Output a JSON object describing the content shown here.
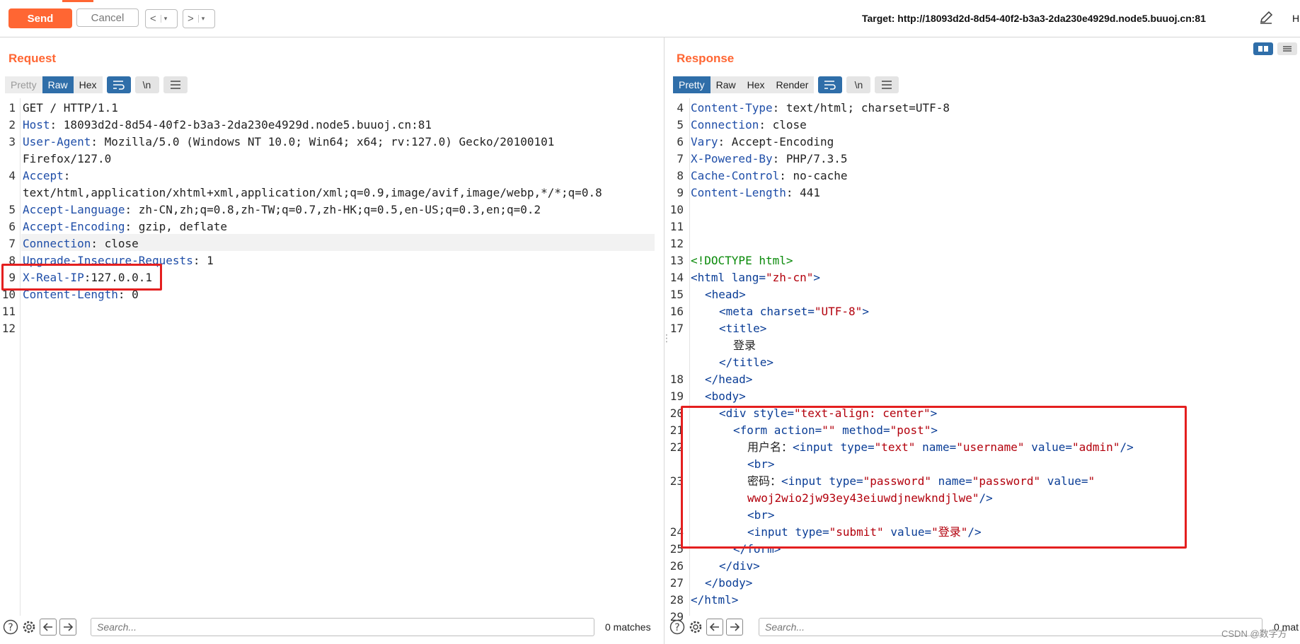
{
  "toolbar": {
    "send_label": "Send",
    "cancel_label": "Cancel",
    "back_label": "<",
    "forward_label": ">",
    "dropdown_glyph": "▾",
    "target_text": "Target: http://18093d2d-8d54-40f2-b3a3-2da230e4929d.node5.buuoj.cn:81",
    "edit_icon": "pencil-icon",
    "cut_text": "H"
  },
  "colors": {
    "accent": "#ff6633",
    "active_tab": "#2f6ea9",
    "highlight_box": "#e41f1f"
  },
  "request": {
    "title": "Request",
    "tabs": [
      "Pretty",
      "Raw",
      "Hex"
    ],
    "active_tab": "Raw",
    "tool_buttons": [
      "wrap-icon",
      "\\n",
      "menu-icon"
    ],
    "lines": [
      {
        "n": "1",
        "k": "GET / HTTP/1.1",
        "v": ""
      },
      {
        "n": "2",
        "k": "Host",
        "v": ": 18093d2d-8d54-40f2-b3a3-2da230e4929d.node5.buuoj.cn:81"
      },
      {
        "n": "3",
        "k": "User-Agent",
        "v": ": Mozilla/5.0 (Windows NT 10.0; Win64; x64; rv:127.0) Gecko/20100101"
      },
      {
        "n": "",
        "k": "",
        "v": "Firefox/127.0"
      },
      {
        "n": "4",
        "k": "Accept",
        "v": ":"
      },
      {
        "n": "",
        "k": "",
        "v": "text/html,application/xhtml+xml,application/xml;q=0.9,image/avif,image/webp,*/*;q=0.8"
      },
      {
        "n": "5",
        "k": "Accept-Language",
        "v": ": zh-CN,zh;q=0.8,zh-TW;q=0.7,zh-HK;q=0.5,en-US;q=0.3,en;q=0.2"
      },
      {
        "n": "6",
        "k": "Accept-Encoding",
        "v": ": gzip, deflate"
      },
      {
        "n": "7",
        "k": "Connection",
        "v": ": close"
      },
      {
        "n": "8",
        "k": "Upgrade-Insecure-Requests",
        "v": ": 1"
      },
      {
        "n": "9",
        "k": "X-Real-IP",
        "v": ":127.0.0.1"
      },
      {
        "n": "10",
        "k": "Content-Length",
        "v": ": 0"
      },
      {
        "n": "11",
        "k": "",
        "v": ""
      },
      {
        "n": "12",
        "k": "",
        "v": ""
      }
    ],
    "search_placeholder": "Search...",
    "matches_text": "0 matches"
  },
  "response": {
    "title": "Response",
    "tabs": [
      "Pretty",
      "Raw",
      "Hex",
      "Render"
    ],
    "active_tab": "Pretty",
    "tool_buttons": [
      "wrap-icon",
      "\\n",
      "menu-icon"
    ],
    "lines": [
      {
        "n": "4",
        "indent": 0,
        "parts": [
          [
            "hk",
            "Content-Type"
          ],
          [
            "t-txt",
            ": text/html; charset=UTF-8"
          ]
        ]
      },
      {
        "n": "5",
        "indent": 0,
        "parts": [
          [
            "hk",
            "Connection"
          ],
          [
            "t-txt",
            ": close"
          ]
        ]
      },
      {
        "n": "6",
        "indent": 0,
        "parts": [
          [
            "hk",
            "Vary"
          ],
          [
            "t-txt",
            ": Accept-Encoding"
          ]
        ]
      },
      {
        "n": "7",
        "indent": 0,
        "parts": [
          [
            "hk",
            "X-Powered-By"
          ],
          [
            "t-txt",
            ": PHP/7.3.5"
          ]
        ]
      },
      {
        "n": "8",
        "indent": 0,
        "parts": [
          [
            "hk",
            "Cache-Control"
          ],
          [
            "t-txt",
            ": no-cache"
          ]
        ]
      },
      {
        "n": "9",
        "indent": 0,
        "parts": [
          [
            "hk",
            "Content-Length"
          ],
          [
            "t-txt",
            ": 441"
          ]
        ]
      },
      {
        "n": "10",
        "indent": 0,
        "parts": []
      },
      {
        "n": "11",
        "indent": 0,
        "parts": []
      },
      {
        "n": "12",
        "indent": 0,
        "parts": []
      },
      {
        "n": "13",
        "indent": 0,
        "parts": [
          [
            "t-doc",
            "<!DOCTYPE html>"
          ]
        ]
      },
      {
        "n": "14",
        "indent": 0,
        "parts": [
          [
            "t-tag",
            "<html "
          ],
          [
            "t-attr",
            "lang"
          ],
          [
            "t-tag",
            "="
          ],
          [
            "t-val",
            "\"zh-cn\""
          ],
          [
            "t-tag",
            ">"
          ]
        ]
      },
      {
        "n": "15",
        "indent": 1,
        "parts": [
          [
            "t-tag",
            "<head>"
          ]
        ]
      },
      {
        "n": "16",
        "indent": 2,
        "parts": [
          [
            "t-tag",
            "<meta "
          ],
          [
            "t-attr",
            "charset"
          ],
          [
            "t-tag",
            "="
          ],
          [
            "t-val",
            "\"UTF-8\""
          ],
          [
            "t-tag",
            ">"
          ]
        ]
      },
      {
        "n": "17",
        "indent": 2,
        "parts": [
          [
            "t-tag",
            "<title>"
          ]
        ]
      },
      {
        "n": "",
        "indent": 3,
        "parts": [
          [
            "t-txt",
            "登录"
          ]
        ]
      },
      {
        "n": "",
        "indent": 2,
        "parts": [
          [
            "t-tag",
            "</title>"
          ]
        ]
      },
      {
        "n": "18",
        "indent": 1,
        "parts": [
          [
            "t-tag",
            "</head>"
          ]
        ]
      },
      {
        "n": "19",
        "indent": 1,
        "parts": [
          [
            "t-tag",
            "<body>"
          ]
        ]
      },
      {
        "n": "20",
        "indent": 2,
        "parts": [
          [
            "t-tag",
            "<div "
          ],
          [
            "t-attr",
            "style"
          ],
          [
            "t-tag",
            "="
          ],
          [
            "t-val",
            "\"text-align: center\""
          ],
          [
            "t-tag",
            ">"
          ]
        ]
      },
      {
        "n": "21",
        "indent": 3,
        "parts": [
          [
            "t-tag",
            "<form "
          ],
          [
            "t-attr",
            "action"
          ],
          [
            "t-tag",
            "="
          ],
          [
            "t-val",
            "\"\""
          ],
          [
            "t-tag",
            " "
          ],
          [
            "t-attr",
            "method"
          ],
          [
            "t-tag",
            "="
          ],
          [
            "t-val",
            "\"post\""
          ],
          [
            "t-tag",
            ">"
          ]
        ]
      },
      {
        "n": "22",
        "indent": 4,
        "parts": [
          [
            "t-txt",
            "用户名："
          ],
          [
            "t-tag",
            "<input "
          ],
          [
            "t-attr",
            "type"
          ],
          [
            "t-tag",
            "="
          ],
          [
            "t-val",
            "\"text\""
          ],
          [
            "t-tag",
            " "
          ],
          [
            "t-attr",
            "name"
          ],
          [
            "t-tag",
            "="
          ],
          [
            "t-val",
            "\"username\""
          ],
          [
            "t-tag",
            " "
          ],
          [
            "t-attr",
            "value"
          ],
          [
            "t-tag",
            "="
          ],
          [
            "t-val",
            "\"admin\""
          ],
          [
            "t-tag",
            "/>"
          ]
        ]
      },
      {
        "n": "",
        "indent": 4,
        "parts": [
          [
            "t-tag",
            "<br>"
          ]
        ]
      },
      {
        "n": "23",
        "indent": 4,
        "parts": [
          [
            "t-txt",
            "密码："
          ],
          [
            "t-tag",
            "<input "
          ],
          [
            "t-attr",
            "type"
          ],
          [
            "t-tag",
            "="
          ],
          [
            "t-val",
            "\"password\""
          ],
          [
            "t-tag",
            " "
          ],
          [
            "t-attr",
            "name"
          ],
          [
            "t-tag",
            "="
          ],
          [
            "t-val",
            "\"password\""
          ],
          [
            "t-tag",
            " "
          ],
          [
            "t-attr",
            "value"
          ],
          [
            "t-tag",
            "="
          ],
          [
            "t-val",
            "\""
          ]
        ]
      },
      {
        "n": "",
        "indent": 4,
        "parts": [
          [
            "t-val",
            "wwoj2wio2jw93ey43eiuwdjnewkndjlwe\""
          ],
          [
            "t-tag",
            "/>"
          ]
        ]
      },
      {
        "n": "",
        "indent": 4,
        "parts": [
          [
            "t-tag",
            "<br>"
          ]
        ]
      },
      {
        "n": "24",
        "indent": 4,
        "parts": [
          [
            "t-tag",
            "<input "
          ],
          [
            "t-attr",
            "type"
          ],
          [
            "t-tag",
            "="
          ],
          [
            "t-val",
            "\"submit\""
          ],
          [
            "t-tag",
            " "
          ],
          [
            "t-attr",
            "value"
          ],
          [
            "t-tag",
            "="
          ],
          [
            "t-val",
            "\"登录\""
          ],
          [
            "t-tag",
            "/>"
          ]
        ]
      },
      {
        "n": "25",
        "indent": 3,
        "parts": [
          [
            "t-tag",
            "</form>"
          ]
        ]
      },
      {
        "n": "26",
        "indent": 2,
        "parts": [
          [
            "t-tag",
            "</div>"
          ]
        ]
      },
      {
        "n": "27",
        "indent": 1,
        "parts": [
          [
            "t-tag",
            "</body>"
          ]
        ]
      },
      {
        "n": "28",
        "indent": 0,
        "parts": [
          [
            "t-tag",
            "</html>"
          ]
        ]
      },
      {
        "n": "29",
        "indent": 0,
        "parts": []
      }
    ],
    "search_placeholder": "Search...",
    "matches_text": "0 mat"
  },
  "watermark": "CSDN @数字方"
}
